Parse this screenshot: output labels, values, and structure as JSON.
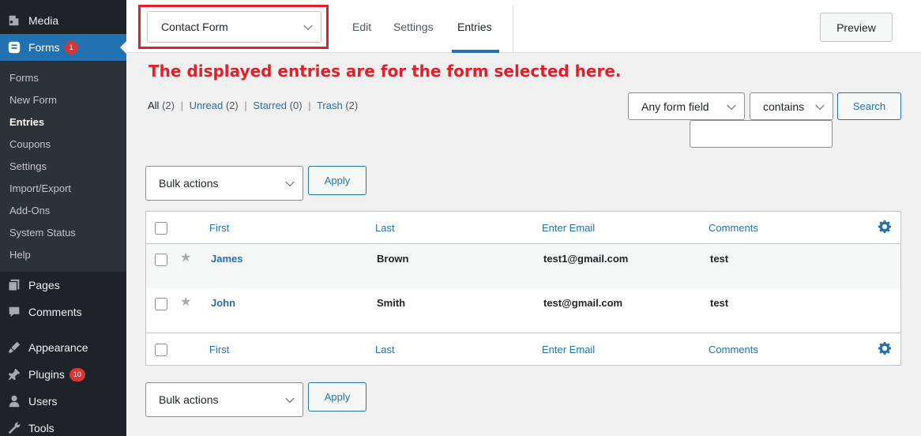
{
  "sidebar": {
    "top_items": [
      {
        "label": "Media",
        "icon": "media-icon"
      },
      {
        "label": "Forms",
        "icon": "forms-icon",
        "badge": "1"
      },
      {
        "label": "Pages",
        "icon": "pages-icon"
      },
      {
        "label": "Comments",
        "icon": "comments-icon"
      },
      {
        "label": "Appearance",
        "icon": "appearance-icon"
      },
      {
        "label": "Plugins",
        "icon": "plugins-icon",
        "badge": "10"
      },
      {
        "label": "Users",
        "icon": "users-icon"
      },
      {
        "label": "Tools",
        "icon": "tools-icon"
      }
    ],
    "submenu": [
      "Forms",
      "New Form",
      "Entries",
      "Coupons",
      "Settings",
      "Import/Export",
      "Add-Ons",
      "System Status",
      "Help"
    ]
  },
  "header": {
    "form_select_value": "Contact Form",
    "tabs": [
      "Edit",
      "Settings",
      "Entries"
    ],
    "preview_label": "Preview"
  },
  "annotation": "The displayed entries are for the form selected here.",
  "filters": {
    "all": "All",
    "all_count": "(2)",
    "unread": "Unread",
    "unread_count": "(2)",
    "starred": "Starred",
    "starred_count": "(0)",
    "trash": "Trash",
    "trash_count": "(2)"
  },
  "search": {
    "field_select": "Any form field",
    "operator_select": "contains",
    "button_label": "Search",
    "input_value": ""
  },
  "bulk": {
    "select_label": "Bulk actions",
    "apply_label": "Apply"
  },
  "table": {
    "columns": [
      "First",
      "Last",
      "Enter Email",
      "Comments"
    ],
    "rows": [
      {
        "first": "James",
        "last": "Brown",
        "email": "test1@gmail.com",
        "comments": "test"
      },
      {
        "first": "John",
        "last": "Smith",
        "email": "test@gmail.com",
        "comments": "test"
      }
    ]
  },
  "colors": {
    "accent": "#2271b1",
    "annotation": "#e0202a",
    "sidebar_bg": "#1d2327",
    "badge": "#d63638"
  }
}
